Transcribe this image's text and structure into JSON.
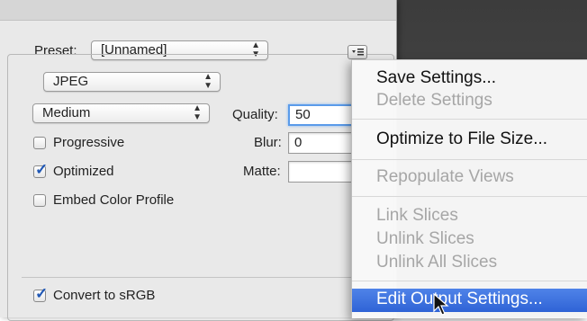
{
  "preset": {
    "label": "Preset:",
    "value": "[Unnamed]"
  },
  "format": {
    "value": "JPEG"
  },
  "quality_preset": {
    "value": "Medium"
  },
  "quality": {
    "label": "Quality:",
    "value": "50"
  },
  "blur": {
    "label": "Blur:",
    "value": "0"
  },
  "matte": {
    "label": "Matte:",
    "value": ""
  },
  "options": {
    "progressive": {
      "label": "Progressive",
      "checked": false
    },
    "optimized": {
      "label": "Optimized",
      "checked": true
    },
    "embed_color_profile": {
      "label": "Embed Color Profile",
      "checked": false
    },
    "convert_srgb": {
      "label": "Convert to sRGB",
      "checked": true
    }
  },
  "menu": {
    "items": [
      {
        "label": "Save Settings...",
        "enabled": true
      },
      {
        "label": "Delete Settings",
        "enabled": false
      },
      {
        "label": "Optimize to File Size...",
        "enabled": true
      },
      {
        "label": "Repopulate Views",
        "enabled": false
      },
      {
        "label": "Link Slices",
        "enabled": false
      },
      {
        "label": "Unlink Slices",
        "enabled": false
      },
      {
        "label": "Unlink All Slices",
        "enabled": false
      },
      {
        "label": "Edit Output Settings...",
        "enabled": true,
        "selected": true
      }
    ]
  },
  "colors": {
    "selection": "#3b6fe0",
    "focus_ring": "#5a9bea",
    "disabled_text": "#a6a6a6"
  },
  "icons": {
    "menu_button": "list-menu-icon",
    "popup_arrows": "up-down-arrows-icon",
    "check": "checkmark-icon",
    "cursor": "arrow-cursor-icon"
  }
}
